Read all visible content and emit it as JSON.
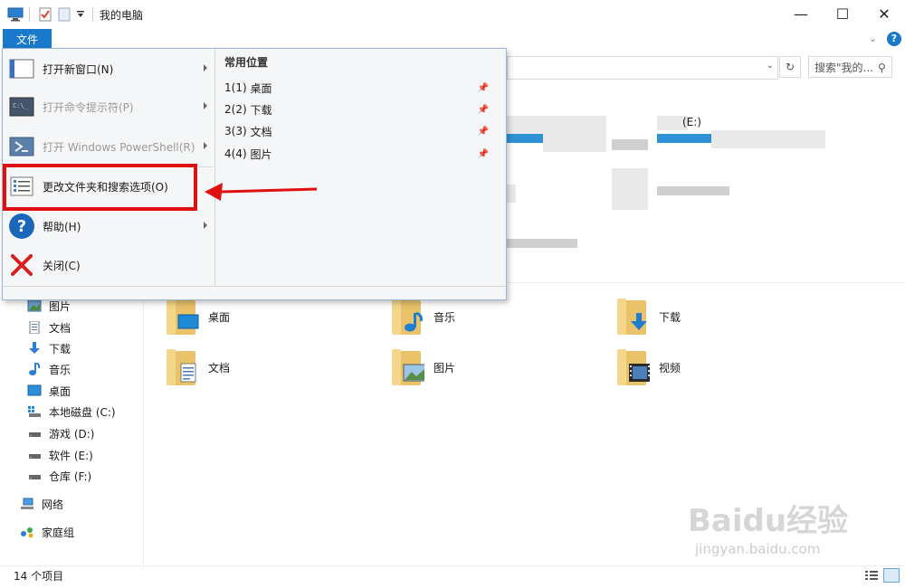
{
  "window": {
    "title": "我的电脑",
    "controls": {
      "minimize": "—",
      "maximize": "☐",
      "close": "✕"
    }
  },
  "ribbon": {
    "file_tab": "文件"
  },
  "address": {
    "search_placeholder": "搜索\"我的..."
  },
  "file_menu": {
    "items": [
      {
        "label": "打开新窗口(N)",
        "icon": "window-icon",
        "enabled": true,
        "submenu": true
      },
      {
        "label": "打开命令提示符(P)",
        "icon": "cmd-icon",
        "enabled": false,
        "submenu": true
      },
      {
        "label": "打开 Windows PowerShell(R)",
        "icon": "powershell-icon",
        "enabled": false,
        "submenu": true
      },
      {
        "label": "更改文件夹和搜索选项(O)",
        "icon": "folder-options-icon",
        "enabled": true,
        "submenu": false
      },
      {
        "label": "帮助(H)",
        "icon": "help-icon",
        "enabled": true,
        "submenu": true
      },
      {
        "label": "关闭(C)",
        "icon": "close-icon",
        "enabled": true,
        "submenu": false
      }
    ],
    "frequent_title": "常用位置",
    "frequent": [
      {
        "index": "1(1)",
        "label": "桌面"
      },
      {
        "index": "2(2)",
        "label": "下载"
      },
      {
        "index": "3(3)",
        "label": "文档"
      },
      {
        "index": "4(4)",
        "label": "图片"
      }
    ]
  },
  "drive_peek": {
    "label": "(E:)"
  },
  "nav": {
    "items": [
      {
        "label": "图片",
        "icon": "pictures-icon"
      },
      {
        "label": "文档",
        "icon": "documents-icon"
      },
      {
        "label": "下载",
        "icon": "download-icon"
      },
      {
        "label": "音乐",
        "icon": "music-icon"
      },
      {
        "label": "桌面",
        "icon": "desktop-icon"
      },
      {
        "label": "本地磁盘 (C:)",
        "icon": "windows-drive-icon"
      },
      {
        "label": "游戏 (D:)",
        "icon": "drive-icon"
      },
      {
        "label": "软件 (E:)",
        "icon": "drive-icon"
      },
      {
        "label": "仓库 (F:)",
        "icon": "drive-icon"
      },
      {
        "label": "网络",
        "icon": "network-icon"
      },
      {
        "label": "家庭组",
        "icon": "homegroup-icon"
      }
    ]
  },
  "folders": [
    {
      "label": "桌面",
      "icon": "desktop-folder-icon"
    },
    {
      "label": "音乐",
      "icon": "music-folder-icon"
    },
    {
      "label": "下载",
      "icon": "download-folder-icon"
    },
    {
      "label": "文档",
      "icon": "documents-folder-icon"
    },
    {
      "label": "图片",
      "icon": "pictures-folder-icon"
    },
    {
      "label": "视频",
      "icon": "videos-folder-icon"
    }
  ],
  "status": {
    "item_count": "14 个项目"
  },
  "watermark": {
    "brand": "Baidu经验",
    "url": "jingyan.baidu.com"
  },
  "colors": {
    "accent": "#1979ca",
    "highlight": "#e01010"
  }
}
